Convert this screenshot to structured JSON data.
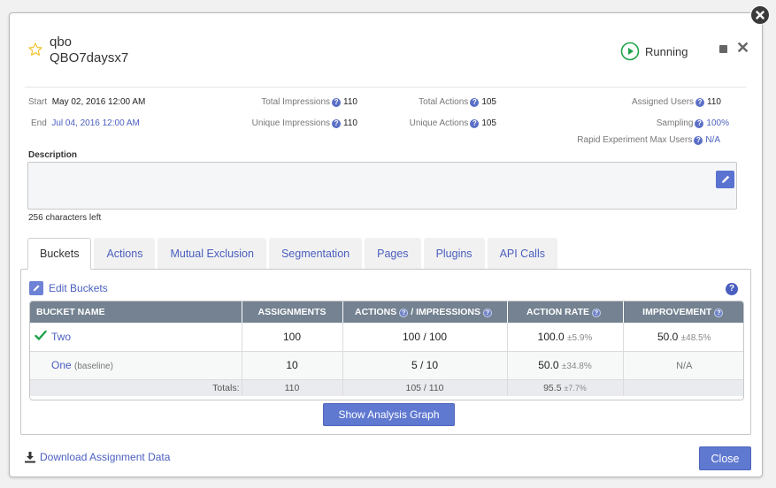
{
  "header": {
    "project": "qbo",
    "experiment": "QBO7daysx7",
    "status": "Running",
    "colors": {
      "running": "#1fa34a",
      "accent": "#5f78d0",
      "star": "#f2c330"
    }
  },
  "meta": {
    "start_label": "Start",
    "start_value": "May 02, 2016 12:00 AM",
    "end_label": "End",
    "end_value": "Jul 04, 2016 12:00 AM",
    "total_impressions_label": "Total Impressions",
    "total_impressions": "110",
    "unique_impressions_label": "Unique Impressions",
    "unique_impressions": "110",
    "total_actions_label": "Total Actions",
    "total_actions": "105",
    "unique_actions_label": "Unique Actions",
    "unique_actions": "105",
    "assigned_users_label": "Assigned Users",
    "assigned_users": "110",
    "sampling_label": "Sampling",
    "sampling": "100%",
    "rapid_label": "Rapid Experiment Max Users",
    "rapid": "N/A"
  },
  "description": {
    "label": "Description",
    "value": "",
    "chars_left": "256 characters left"
  },
  "tabs": [
    {
      "label": "Buckets",
      "active": true
    },
    {
      "label": "Actions"
    },
    {
      "label": "Mutual Exclusion"
    },
    {
      "label": "Segmentation"
    },
    {
      "label": "Pages"
    },
    {
      "label": "Plugins"
    },
    {
      "label": "API Calls"
    }
  ],
  "buckets": {
    "edit_label": "Edit Buckets",
    "columns": {
      "name": "BUCKET NAME",
      "assignments": "ASSIGNMENTS",
      "actions": "ACTIONS",
      "impressions": "/ IMPRESSIONS",
      "action_rate": "ACTION RATE",
      "improvement": "IMPROVEMENT"
    },
    "rows": [
      {
        "name": "Two",
        "tag": "",
        "winner": true,
        "assignments": "100",
        "actions_impressions": "100 / 100",
        "rate": "100.0",
        "rate_pm": "±5.9%",
        "improvement": "50.0",
        "improvement_pm": "±48.5%"
      },
      {
        "name": "One",
        "tag": "(baseline)",
        "winner": false,
        "assignments": "10",
        "actions_impressions": "5 / 10",
        "rate": "50.0",
        "rate_pm": "±34.8%",
        "improvement": "N/A",
        "improvement_pm": ""
      }
    ],
    "totals": {
      "label": "Totals:",
      "assignments": "110",
      "actions_impressions": "105 / 110",
      "rate": "95.5",
      "rate_pm": "±7.7%"
    },
    "graph_button": "Show Analysis Graph"
  },
  "footer": {
    "download_label": "Download Assignment Data",
    "close_label": "Close"
  }
}
